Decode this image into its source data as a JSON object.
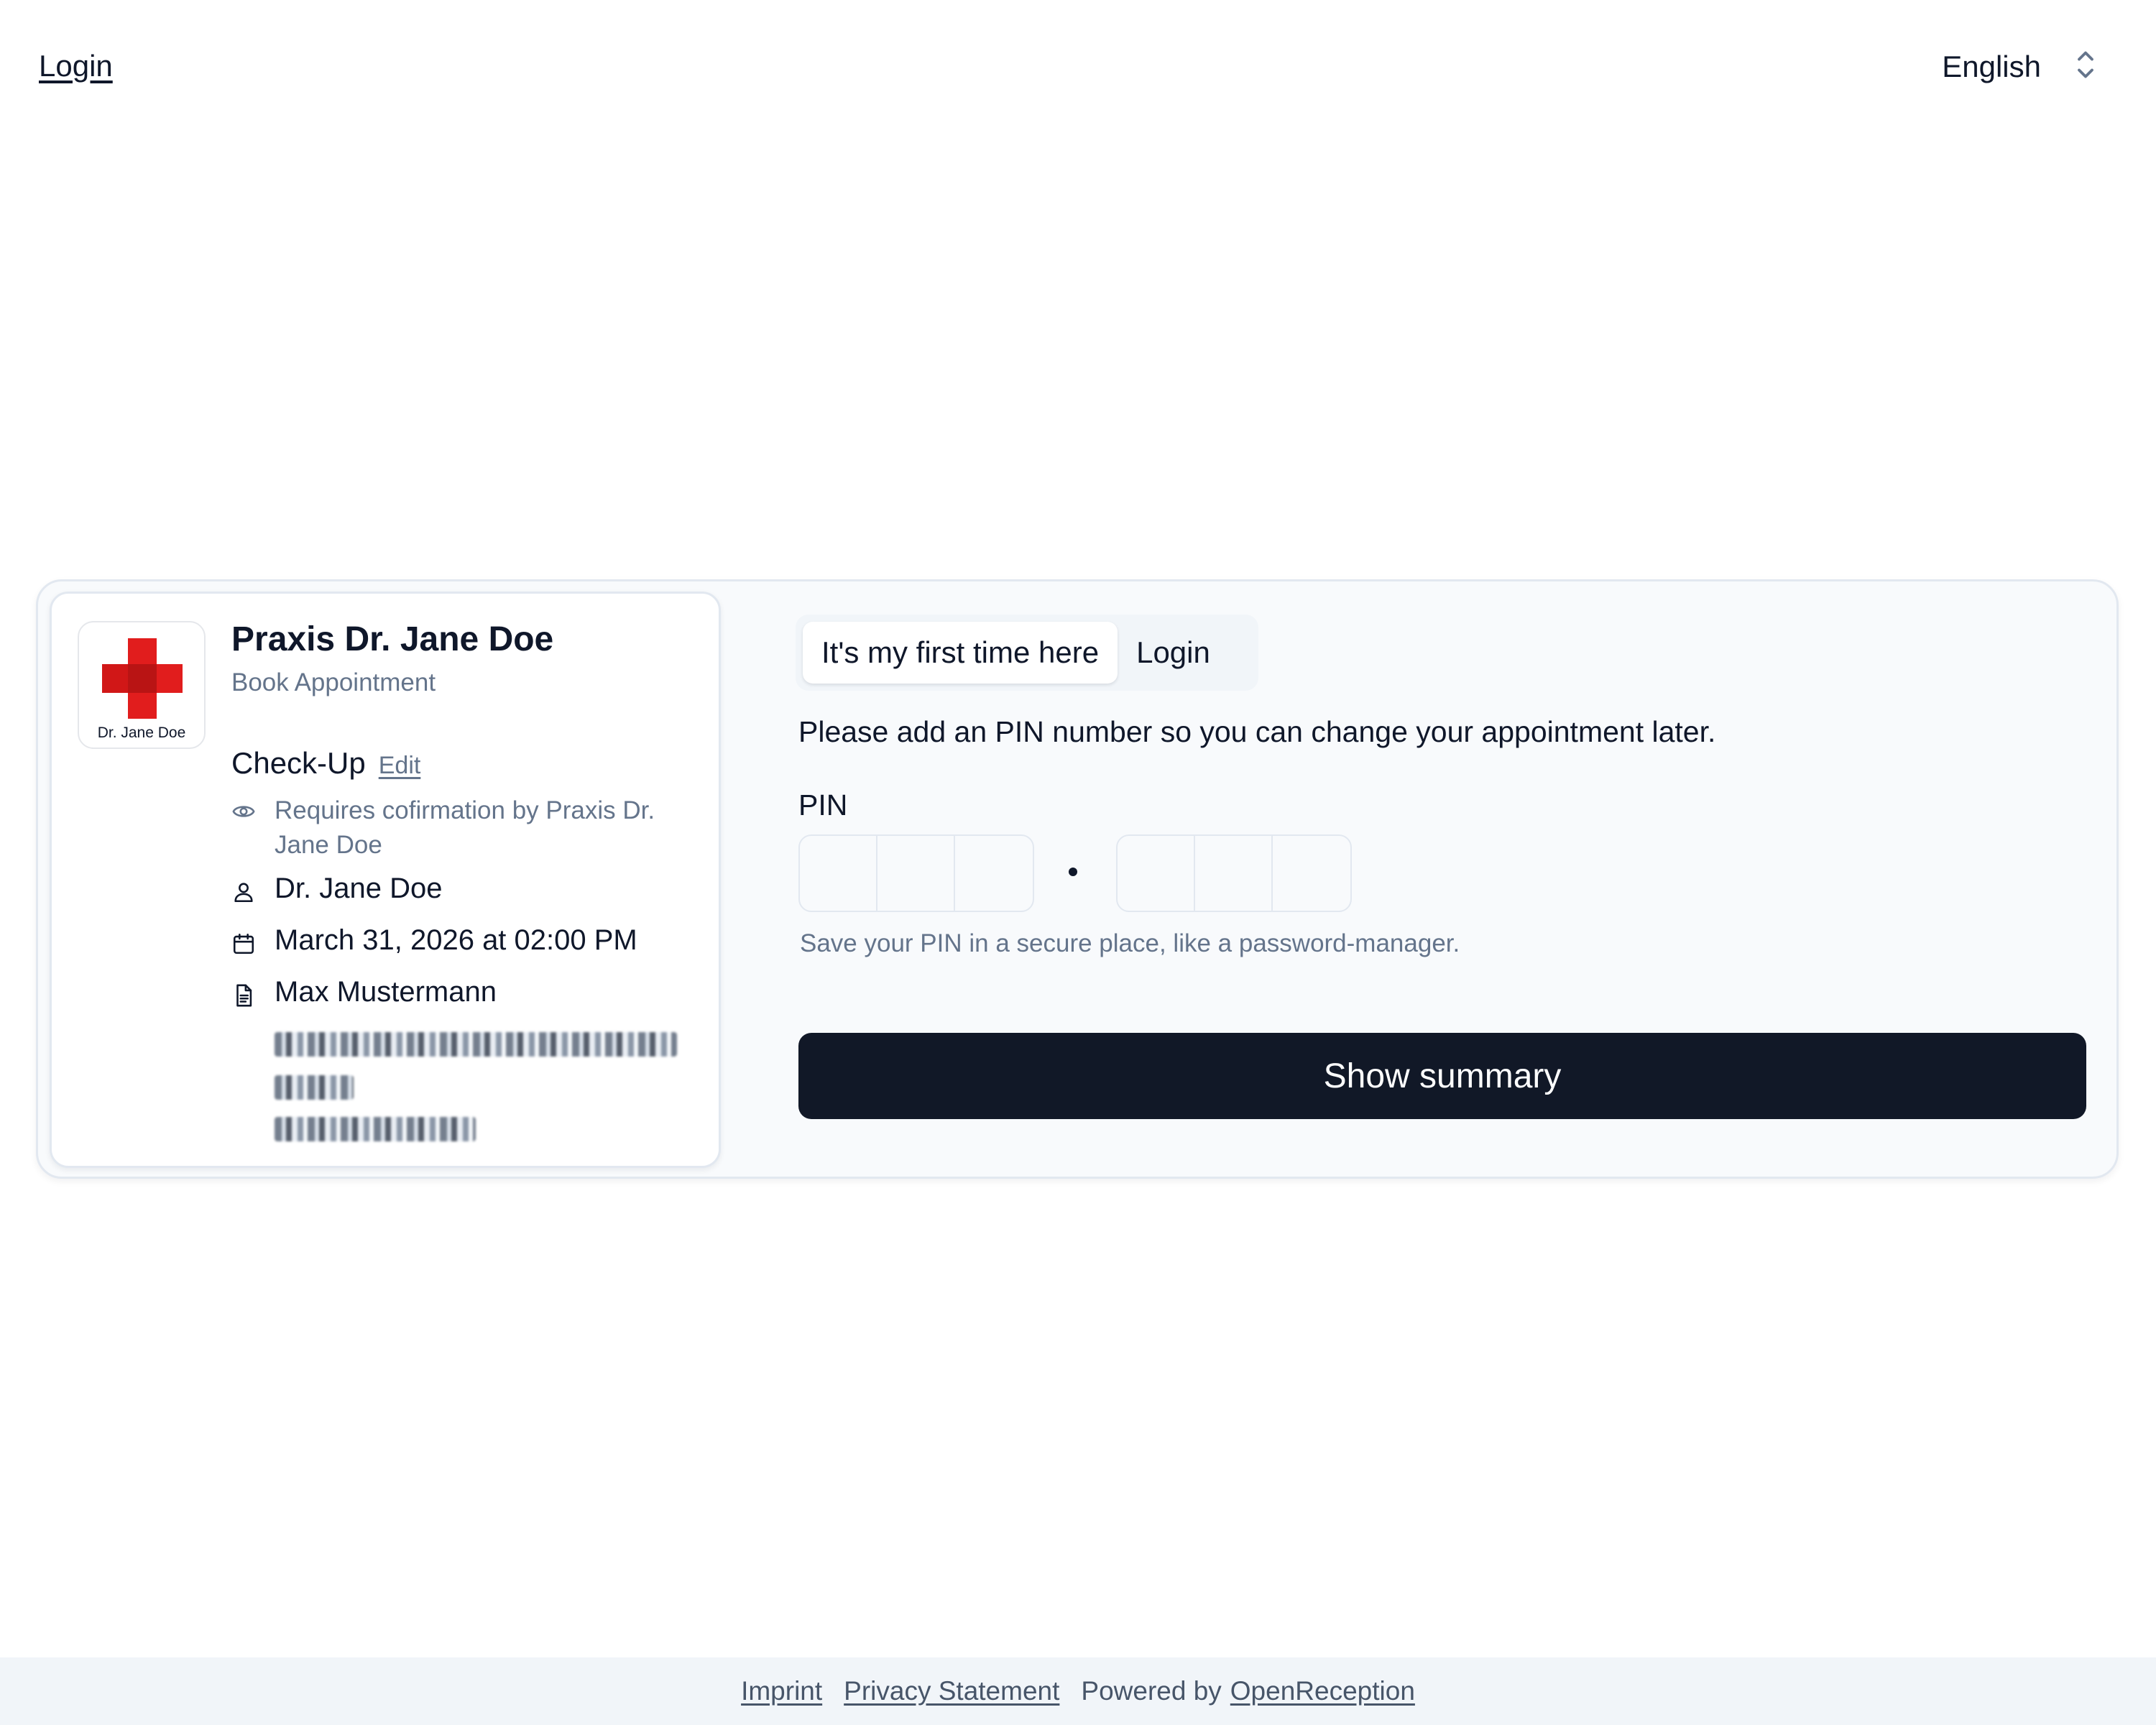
{
  "header": {
    "login_link": "Login",
    "language": {
      "selected": "English",
      "icon": "chevron-up-down-icon"
    }
  },
  "summary": {
    "logo": {
      "caption": "Dr. Jane Doe",
      "icon": "red-cross-logo",
      "color": "#e11d1d"
    },
    "practice_name": "Praxis Dr. Jane Doe",
    "subtitle": "Book Appointment",
    "service": {
      "name": "Check-Up",
      "edit_label": "Edit"
    },
    "confirmation": {
      "icon": "eye-icon",
      "text": "Requires cofirmation by Praxis Dr. Jane Doe"
    },
    "doctor": {
      "icon": "person-icon",
      "text": "Dr. Jane Doe"
    },
    "datetime": {
      "icon": "calendar-icon",
      "text": "March 31, 2026 at 02:00 PM"
    },
    "patient": {
      "icon": "document-icon",
      "text": "Max Mustermann"
    }
  },
  "form": {
    "tabs": [
      {
        "label": "It's my first time here",
        "active": true
      },
      {
        "label": "Login",
        "active": false
      }
    ],
    "instruction": "Please add an PIN number so you can change your appointment later.",
    "pin_label": "PIN",
    "pin_help": "Save your PIN in a secure place, like a password-manager.",
    "submit_label": "Show summary"
  },
  "footer": {
    "imprint": "Imprint",
    "privacy": "Privacy Statement",
    "powered_by": "Powered by",
    "brand": "OpenReception"
  },
  "colors": {
    "button_bg": "#111827",
    "muted_text": "#64748b",
    "card_bg": "#f8fafc",
    "footer_bg": "#f1f5f9"
  }
}
